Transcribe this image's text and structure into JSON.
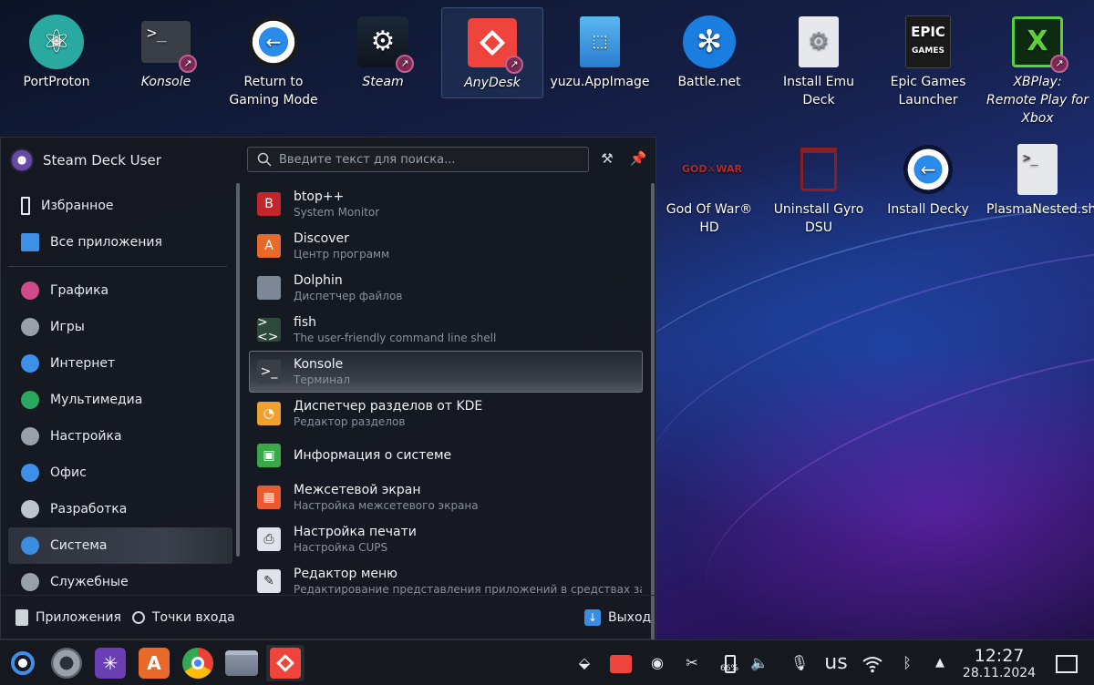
{
  "desktop": {
    "icons": [
      {
        "label": "PortProton",
        "italic": false,
        "icon": "portproton-icon"
      },
      {
        "label": "Konsole",
        "italic": true,
        "icon": "konsole-icon",
        "link": true
      },
      {
        "label": "Return to Gaming Mode",
        "italic": false,
        "icon": "return-gaming-icon"
      },
      {
        "label": "Steam",
        "italic": true,
        "icon": "steam-icon",
        "link": true
      },
      {
        "label": "AnyDesk",
        "italic": true,
        "icon": "anydesk-icon",
        "link": true,
        "selected": true
      },
      {
        "label": "yuzu.AppImage",
        "italic": false,
        "icon": "appimage-file-icon"
      },
      {
        "label": "Battle.net",
        "italic": false,
        "icon": "battlenet-icon"
      },
      {
        "label": "Install Emu Deck",
        "italic": false,
        "icon": "emudeck-file-icon"
      },
      {
        "label": "Epic Games Launcher",
        "italic": false,
        "icon": "epic-games-icon"
      },
      {
        "label": "XBPlay: Remote Play for Xbox",
        "italic": true,
        "icon": "xbplay-icon",
        "link": true
      },
      {
        "label": "God Of War® HD",
        "italic": false,
        "icon": "god-of-war-icon"
      },
      {
        "label": "Uninstall Gyro DSU",
        "italic": false,
        "icon": "trash-icon"
      },
      {
        "label": "Install Decky",
        "italic": false,
        "icon": "decky-icon"
      },
      {
        "label": "PlasmaNested.sh",
        "italic": false,
        "icon": "script-file-icon"
      }
    ]
  },
  "launcher": {
    "user": "Steam Deck User",
    "search_placeholder": "Введите текст для поиска...",
    "categories_top": [
      "Избранное",
      "Все приложения"
    ],
    "categories": [
      "Графика",
      "Игры",
      "Интернет",
      "Мультимедиа",
      "Настройка",
      "Офис",
      "Разработка",
      "Система",
      "Служебные"
    ],
    "active_category": "Система",
    "apps": [
      {
        "name": "btop++",
        "desc": "System Monitor",
        "icon_color": "#c0262b",
        "glyph": "B"
      },
      {
        "name": "Discover",
        "desc": "Центр программ",
        "icon_color": "#e86a2a",
        "glyph": "A"
      },
      {
        "name": "Dolphin",
        "desc": "Диспетчер файлов",
        "icon_color": "#7d8796",
        "glyph": ""
      },
      {
        "name": "fish",
        "desc": "The user-friendly command line shell",
        "icon_color": "#2e4a3a",
        "glyph": "><>"
      },
      {
        "name": "Konsole",
        "desc": "Терминал",
        "icon_color": "#3a3f47",
        "glyph": ">_"
      },
      {
        "name": "Диспетчер разделов от KDE",
        "desc": "Редактор разделов",
        "icon_color": "#f0a030",
        "glyph": "◔"
      },
      {
        "name": "Информация о системе",
        "desc": "",
        "icon_color": "#3aa848",
        "glyph": "▣"
      },
      {
        "name": "Межсетевой экран",
        "desc": "Настройка межсетевого экрана",
        "icon_color": "#e85a30",
        "glyph": "▦"
      },
      {
        "name": "Настройка печати",
        "desc": "Настройка CUPS",
        "icon_color": "#dfe3ea",
        "glyph": "⎙"
      },
      {
        "name": "Редактор меню",
        "desc": "Редактирование представления приложений в средствах запуска",
        "icon_color": "#dfe3ea",
        "glyph": "✎"
      }
    ],
    "active_app": "Konsole",
    "footer": {
      "apps": "Приложения",
      "places": "Точки входа",
      "leave": "Выход"
    }
  },
  "taskbar": {
    "keyboard_layout": "us",
    "time": "12:27",
    "date": "28.11.2024",
    "battery": "66%"
  },
  "colors": {
    "accent": "#3d8fe8",
    "anydesk": "#ef443b"
  }
}
